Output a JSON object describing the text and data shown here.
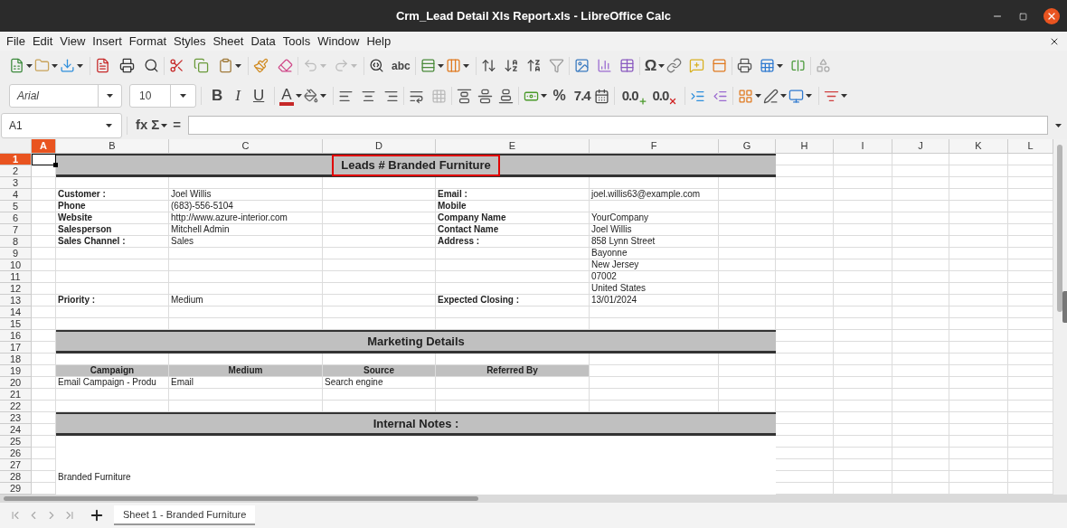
{
  "window": {
    "title": "Crm_Lead Detail Xls Report.xls - LibreOffice Calc"
  },
  "menu": [
    "File",
    "Edit",
    "View",
    "Insert",
    "Format",
    "Styles",
    "Sheet",
    "Data",
    "Tools",
    "Window",
    "Help"
  ],
  "toolbar": {
    "glyphs": [
      "abc",
      "Ω"
    ]
  },
  "format_bar": {
    "font": "Arial",
    "size": "10",
    "glyphs": [
      "B",
      "I",
      "U",
      "A",
      "%",
      "7.4",
      "0.0",
      "0.0"
    ]
  },
  "formula_bar": {
    "name_box": "A1",
    "glyphs": [
      "fx",
      "Σ",
      "="
    ]
  },
  "columns": [
    {
      "label": "A",
      "selected": true
    },
    {
      "label": "B",
      "selected": false
    },
    {
      "label": "C",
      "selected": false
    },
    {
      "label": "D",
      "selected": false
    },
    {
      "label": "E",
      "selected": false
    },
    {
      "label": "F",
      "selected": false
    },
    {
      "label": "G",
      "selected": false
    },
    {
      "label": "H",
      "selected": false
    },
    {
      "label": "I",
      "selected": false
    },
    {
      "label": "J",
      "selected": false
    },
    {
      "label": "K",
      "selected": false
    },
    {
      "label": "L",
      "selected": false
    }
  ],
  "rows": [
    {
      "label": "1",
      "selected": true
    },
    {
      "label": "2",
      "selected": false
    },
    {
      "label": "3",
      "selected": false
    },
    {
      "label": "4",
      "selected": false
    },
    {
      "label": "5",
      "selected": false
    },
    {
      "label": "6",
      "selected": false
    },
    {
      "label": "7",
      "selected": false
    },
    {
      "label": "8",
      "selected": false
    },
    {
      "label": "9",
      "selected": false
    },
    {
      "label": "10",
      "selected": false
    },
    {
      "label": "11",
      "selected": false
    },
    {
      "label": "12",
      "selected": false
    },
    {
      "label": "13",
      "selected": false
    },
    {
      "label": "14",
      "selected": false
    },
    {
      "label": "15",
      "selected": false
    },
    {
      "label": "16",
      "selected": false
    },
    {
      "label": "17",
      "selected": false
    },
    {
      "label": "18",
      "selected": false
    },
    {
      "label": "19",
      "selected": false
    },
    {
      "label": "20",
      "selected": false
    },
    {
      "label": "21",
      "selected": false
    },
    {
      "label": "22",
      "selected": false
    },
    {
      "label": "23",
      "selected": false
    },
    {
      "label": "24",
      "selected": false
    },
    {
      "label": "25",
      "selected": false
    },
    {
      "label": "26",
      "selected": false
    },
    {
      "label": "27",
      "selected": false
    },
    {
      "label": "28",
      "selected": false
    },
    {
      "label": "29",
      "selected": false
    }
  ],
  "report": {
    "title": {
      "text": "Leads # Branded Furniture",
      "highlighted": true
    },
    "details": [
      {
        "left": {
          "label": "Customer :",
          "value": "Joel Willis"
        },
        "right": {
          "label": "Email :",
          "value": "joel.willis63@example.com"
        }
      },
      {
        "left": {
          "label": "Phone",
          "value": "(683)-556-5104"
        },
        "right": {
          "label": "Mobile"
        }
      },
      {
        "left": {
          "label": "Website",
          "value": "http://www.azure-interior.com"
        },
        "right": {
          "label": "Company Name",
          "value": "YourCompany"
        }
      },
      {
        "left": {
          "label": "Salesperson",
          "value": "Mitchell Admin"
        },
        "right": {
          "label": "Contact Name",
          "value": "Joel Willis"
        }
      },
      {
        "left": {
          "label": "Sales Channel :",
          "value": "Sales"
        },
        "right": {
          "label": "Address :",
          "lines": [
            "858 Lynn Street",
            "Bayonne",
            "New Jersey",
            "07002",
            "United States"
          ]
        }
      },
      {
        "left": {
          "label": "Priority :",
          "value": "Medium"
        },
        "right": {
          "label": "Expected Closing :",
          "value": "13/01/2024"
        }
      }
    ],
    "marketing": {
      "title": "Marketing Details",
      "columns": [
        "Campaign",
        "Medium",
        "Source",
        "Referred By"
      ],
      "rows": [
        [
          "Email Campaign - Produ",
          "Email",
          "Search engine"
        ]
      ]
    },
    "notes": {
      "title": "Internal Notes :",
      "text": "Branded Furniture"
    }
  },
  "sheets": [
    {
      "label": "Sheet 1 - Branded Furniture",
      "selected": true
    }
  ]
}
